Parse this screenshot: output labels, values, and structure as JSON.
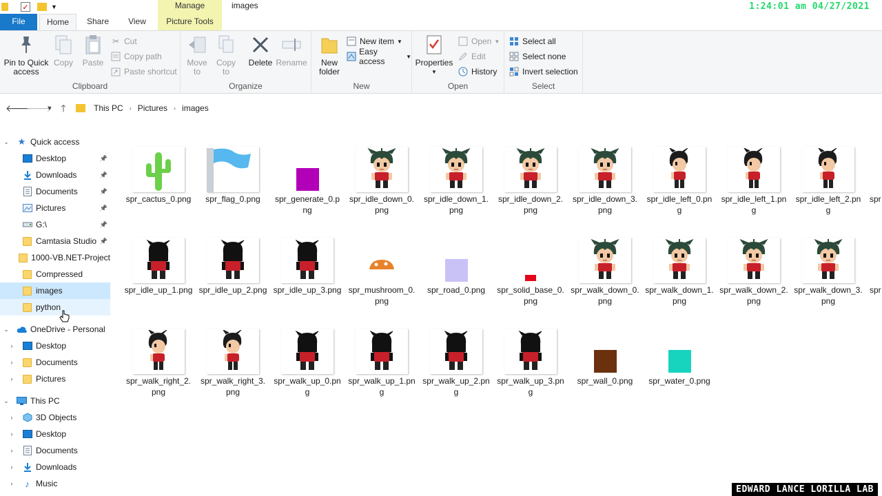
{
  "window": {
    "title": "images",
    "context_tab": "Manage",
    "clock": "1:24:01 am 04/27/2021"
  },
  "tabs": {
    "file": "File",
    "home": "Home",
    "share": "Share",
    "view": "View",
    "picture_tools": "Picture Tools"
  },
  "ribbon": {
    "clipboard": {
      "label": "Clipboard",
      "pin": [
        "Pin to Quick",
        "access"
      ],
      "copy": "Copy",
      "paste": "Paste",
      "cut": "Cut",
      "copy_path": "Copy path",
      "paste_shortcut": "Paste shortcut"
    },
    "organize": {
      "label": "Organize",
      "move_to": [
        "Move",
        "to"
      ],
      "copy_to": [
        "Copy",
        "to"
      ],
      "delete": "Delete",
      "rename": "Rename"
    },
    "new": {
      "label": "New",
      "new_folder": [
        "New",
        "folder"
      ],
      "new_item": "New item",
      "easy_access": "Easy access"
    },
    "open": {
      "label": "Open",
      "properties": "Properties",
      "open": "Open",
      "edit": "Edit",
      "history": "History"
    },
    "select": {
      "label": "Select",
      "select_all": "Select all",
      "select_none": "Select none",
      "invert_selection": "Invert selection"
    }
  },
  "address": {
    "crumbs": [
      "This PC",
      "Pictures",
      "images"
    ]
  },
  "nav": {
    "quick_access": "Quick access",
    "quick_items": [
      "Desktop",
      "Downloads",
      "Documents",
      "Pictures",
      "G:\\",
      "Camtasia Studio",
      "1000-VB.NET-Project",
      "Compressed",
      "images",
      "python"
    ],
    "onedrive": "OneDrive - Personal",
    "onedrive_items": [
      "Desktop",
      "Documents",
      "Pictures"
    ],
    "this_pc": "This PC",
    "pc_items": [
      "3D Objects",
      "Desktop",
      "Documents",
      "Downloads",
      "Music"
    ]
  },
  "files": [
    {
      "name": "spr_cactus_0.png",
      "kind": "cactus"
    },
    {
      "name": "spr_flag_0.png",
      "kind": "flag"
    },
    {
      "name": "spr_generate_0.png",
      "kind": "purple"
    },
    {
      "name": "spr_idle_down_0.png",
      "kind": "char-front"
    },
    {
      "name": "spr_idle_down_1.png",
      "kind": "char-front"
    },
    {
      "name": "spr_idle_down_2.png",
      "kind": "char-front"
    },
    {
      "name": "spr_idle_down_3.png",
      "kind": "char-front"
    },
    {
      "name": "spr_idle_left_0.png",
      "kind": "char-side"
    },
    {
      "name": "spr_idle_left_1.png",
      "kind": "char-side"
    },
    {
      "name": "spr_idle_left_2.png",
      "kind": "char-side"
    },
    {
      "name": "spr_idle_up_1.png",
      "kind": "char-back"
    },
    {
      "name": "spr_idle_up_2.png",
      "kind": "char-back"
    },
    {
      "name": "spr_idle_up_3.png",
      "kind": "char-back"
    },
    {
      "name": "spr_mushroom_0.png",
      "kind": "mushroom"
    },
    {
      "name": "spr_road_0.png",
      "kind": "road"
    },
    {
      "name": "spr_solid_base_0.png",
      "kind": "solid"
    },
    {
      "name": "spr_walk_down_0.png",
      "kind": "char-front"
    },
    {
      "name": "spr_walk_down_1.png",
      "kind": "char-front"
    },
    {
      "name": "spr_walk_down_2.png",
      "kind": "char-front"
    },
    {
      "name": "spr_walk_down_3.png",
      "kind": "char-front"
    },
    {
      "name": "spr_walk_right_2.png",
      "kind": "char-side"
    },
    {
      "name": "spr_walk_right_3.png",
      "kind": "char-side"
    },
    {
      "name": "spr_walk_up_0.png",
      "kind": "char-back"
    },
    {
      "name": "spr_walk_up_1.png",
      "kind": "char-back"
    },
    {
      "name": "spr_walk_up_2.png",
      "kind": "char-back"
    },
    {
      "name": "spr_walk_up_3.png",
      "kind": "char-back"
    },
    {
      "name": "spr_wall_0.png",
      "kind": "wall"
    },
    {
      "name": "spr_water_0.png",
      "kind": "water"
    }
  ],
  "partial_tiles": [
    "spr",
    "spr"
  ],
  "watermark": "EDWARD LANCE LORILLA LAB",
  "colors": {
    "accent": "#1979ca",
    "selection": "#cce8ff",
    "context_tab": "#f2f4b0",
    "clock": "#23d96a"
  }
}
